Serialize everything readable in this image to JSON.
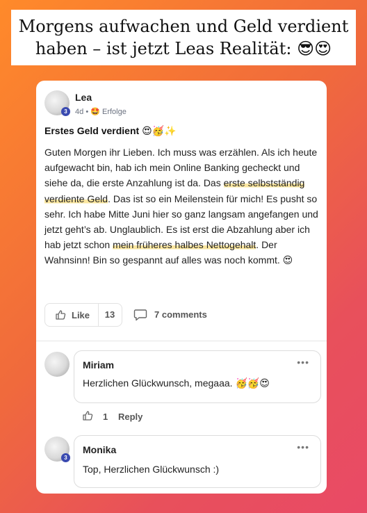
{
  "banner": {
    "line1": "Morgens aufwachen und Geld verdient",
    "line2": "haben – ist jetzt Leas Realität:",
    "emojis": "😎😍"
  },
  "post": {
    "author": "Lea",
    "level": "3",
    "time": "4d",
    "separator": "•",
    "category_emoji": "🤩",
    "category": "Erfolge",
    "title": "Erstes Geld verdient",
    "title_emojis": "😍🥳✨",
    "body": {
      "p1": "Guten Morgen ihr Lieben. Ich muss was erzählen. Als ich heute aufgewacht bin, hab ich mein Online Banking gecheckt und siehe da, die erste Anzahlung ist da. Das ",
      "hl1": "erste selbstständig verdiente Geld",
      "p2": ". Das ist so ein Meilenstein für mich! Es pusht so sehr. Ich habe Mitte Juni hier so ganz langsam angefangen und jetzt geht’s ab. Unglaublich. Es ist erst die Abzahlung aber ich hab jetzt schon ",
      "hl2": "mein früheres halbes Nettogehalt",
      "p3": ". Der Wahnsinn! Bin so gespannt auf alles was noch kommt. ",
      "end_emoji": "😍"
    },
    "like_label": "Like",
    "like_count": "13",
    "comments_label": "7 comments",
    "highlight_color": "#fbe7a0"
  },
  "comments": [
    {
      "author": "Miriam",
      "text": "Herzlichen Glückwunsch, megaaa. ",
      "emojis": "🥳🥳😍",
      "menu": "•••",
      "likes": "1",
      "reply_label": "Reply"
    },
    {
      "author": "Monika",
      "level": "3",
      "text": "Top, Herzlichen Glückwunsch :)",
      "menu": "•••"
    }
  ],
  "colors": {
    "gradient_start": "#ff8a2a",
    "gradient_end": "#e94a66",
    "level_badge": "#3a4ab0"
  },
  "icons": [
    "thumbs-up-icon",
    "comment-icon",
    "more-icon"
  ]
}
